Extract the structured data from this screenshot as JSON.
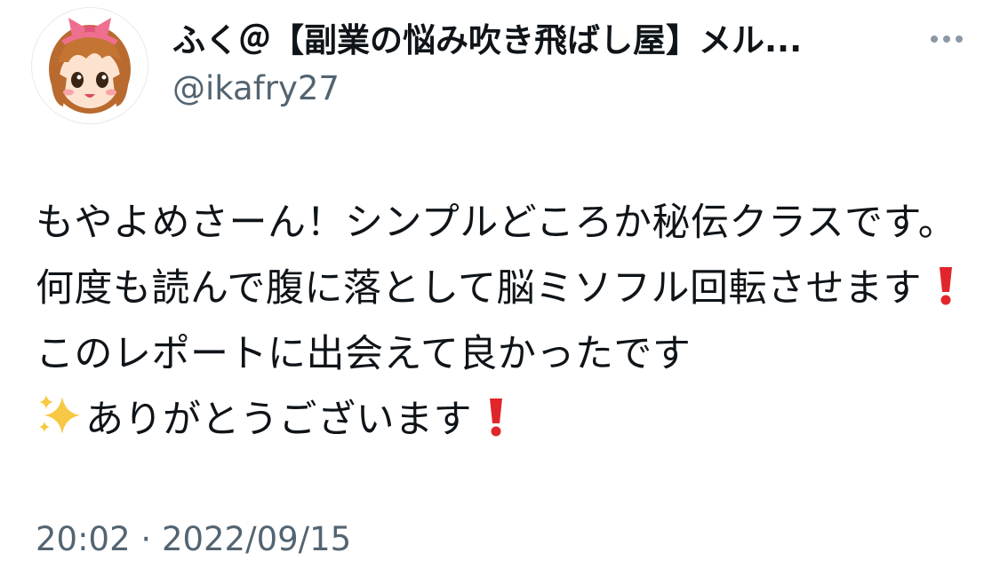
{
  "tweet": {
    "author": {
      "display_name": "ふく＠【副業の悩み吹き飛ばし屋】メル...",
      "handle": "@ikafry27",
      "avatar_icon": "anime-girl-avatar-icon"
    },
    "more_icon": "more-dots-icon",
    "body": {
      "part1": "もやよめさーん！シンプルどころか秘伝クラスです。何度も読んで腹に落として脳ミソフル回転させます",
      "exclamation_icon_1": "red-exclamation-icon",
      "part2": " このレポートに出会えて良かったです",
      "sparkles_icon": "sparkles-icon",
      "part3": "ありがとうございます",
      "exclamation_icon_2": "red-exclamation-icon"
    },
    "time": "20:02",
    "separator": "·",
    "date": "2022/09/15"
  },
  "colors": {
    "text": "#0f1419",
    "secondary": "#536471",
    "exclamation": "#e0252b",
    "sparkle": "#f7c843"
  }
}
